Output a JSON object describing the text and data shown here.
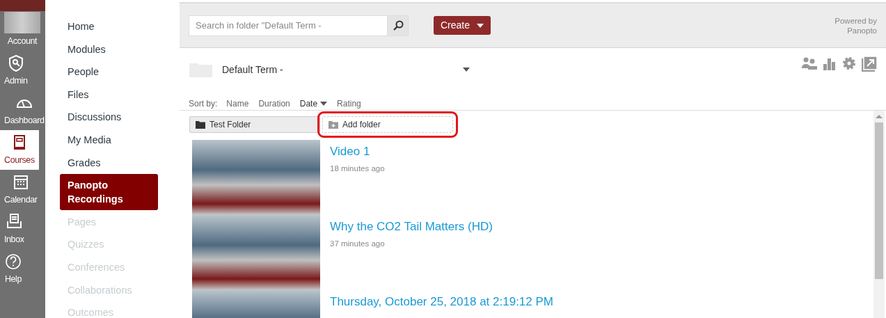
{
  "global_nav": [
    {
      "kind": "avatar",
      "label": "Account",
      "selected": false
    },
    {
      "kind": "admin",
      "label": "Admin",
      "selected": false
    },
    {
      "kind": "dashboard",
      "label": "Dashboard",
      "selected": false
    },
    {
      "kind": "courses",
      "label": "Courses",
      "selected": true
    },
    {
      "kind": "calendar",
      "label": "Calendar",
      "selected": false
    },
    {
      "kind": "inbox",
      "label": "Inbox",
      "selected": false
    },
    {
      "kind": "help",
      "label": "Help",
      "selected": false
    }
  ],
  "course_nav": [
    {
      "label": "Home",
      "selected": false,
      "disabled": false
    },
    {
      "label": "Modules",
      "selected": false,
      "disabled": false
    },
    {
      "label": "People",
      "selected": false,
      "disabled": false
    },
    {
      "label": "Files",
      "selected": false,
      "disabled": false
    },
    {
      "label": "Discussions",
      "selected": false,
      "disabled": false
    },
    {
      "label": "My Media",
      "selected": false,
      "disabled": false
    },
    {
      "label": "Grades",
      "selected": false,
      "disabled": false
    },
    {
      "label": "Panopto Recordings",
      "selected": true,
      "disabled": false
    },
    {
      "label": "Pages",
      "selected": false,
      "disabled": true
    },
    {
      "label": "Quizzes",
      "selected": false,
      "disabled": true
    },
    {
      "label": "Conferences",
      "selected": false,
      "disabled": true
    },
    {
      "label": "Collaborations",
      "selected": false,
      "disabled": true
    },
    {
      "label": "Outcomes",
      "selected": false,
      "disabled": true
    }
  ],
  "toolbar": {
    "search": {
      "placeholder": "Search in folder \"Default Term - "
    },
    "create_button": "Create",
    "powered_by": "Powered by Panopto"
  },
  "folder": {
    "title": "Default Term - "
  },
  "sort": {
    "label": "Sort by:",
    "options": [
      {
        "label": "Name",
        "selected": false
      },
      {
        "label": "Duration",
        "selected": false
      },
      {
        "label": "Date",
        "selected": true
      },
      {
        "label": "Rating",
        "selected": false
      }
    ]
  },
  "folders": [
    {
      "kind": "folder",
      "label": "Test Folder",
      "highlighted": false
    },
    {
      "kind": "add",
      "label": "Add folder",
      "highlighted": true
    }
  ],
  "videos": [
    {
      "title": "Video 1",
      "time": "18 minutes ago"
    },
    {
      "title": "Why the CO2 Tail Matters (HD)",
      "time": "37 minutes ago"
    },
    {
      "title": "Thursday, October 25, 2018 at 2:19:12 PM"
    }
  ]
}
